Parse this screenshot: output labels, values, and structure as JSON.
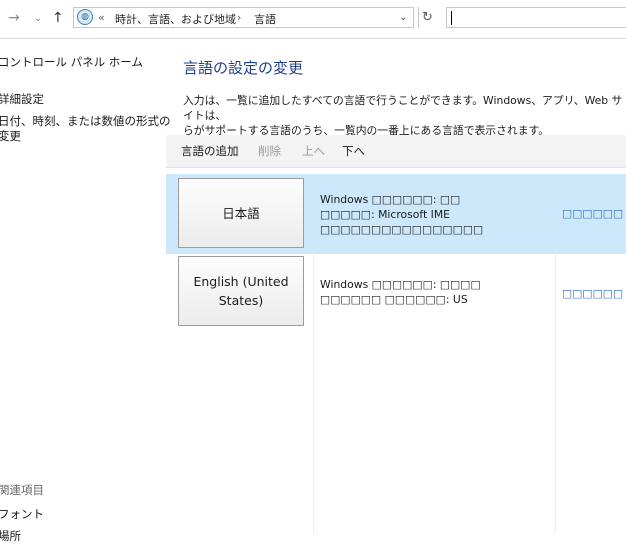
{
  "nav": {
    "forward_icon": "arrow-right-icon",
    "history_icon": "chevron-down-icon",
    "up_icon": "arrow-up-icon",
    "address": {
      "icon": "globe-icon",
      "chevrons": "«",
      "crumb1": "時計、言語、および地域",
      "separator": "›",
      "crumb2": "言語",
      "dropdown_icon": "chevron-down-icon"
    },
    "refresh_icon": "refresh-icon",
    "search_value": ""
  },
  "sidebar": {
    "home": "コントロール パネル ホーム",
    "advanced": "詳細設定",
    "date_line1": "日付、時刻、または数値の形式の",
    "date_line2": "変更",
    "see_also": "関連項目",
    "fonts": "フォント",
    "more": "場所"
  },
  "main": {
    "title": "言語の設定の変更",
    "desc_line1": "入力は、一覧に追加したすべての言語で行うことができます。Windows、アプリ、Web サイトは、",
    "desc_line2": "らがサポートする言語のうち、一覧内の一番上にある言語で表示されます。",
    "toolbar": {
      "add": "言語の追加",
      "remove": "削除",
      "up": "上へ",
      "down": "下へ"
    },
    "languages": [
      {
        "name": "日本語",
        "info1": "Windows □□□□□□: □□",
        "info2": "□□□□□: Microsoft IME",
        "info3": "□□□□□□□□□□□□□□□□",
        "options": "□□□□□□"
      },
      {
        "name_line1": "English (United",
        "name_line2": "States)",
        "info1": "Windows □□□□□□: □□□□",
        "info2": "□□□□□□ □□□□□□: US",
        "options": "□□□□□□"
      }
    ]
  },
  "colors": {
    "title": "#1e3f8a",
    "selected_row": "#cde8fb",
    "link": "#2a6dbd"
  }
}
